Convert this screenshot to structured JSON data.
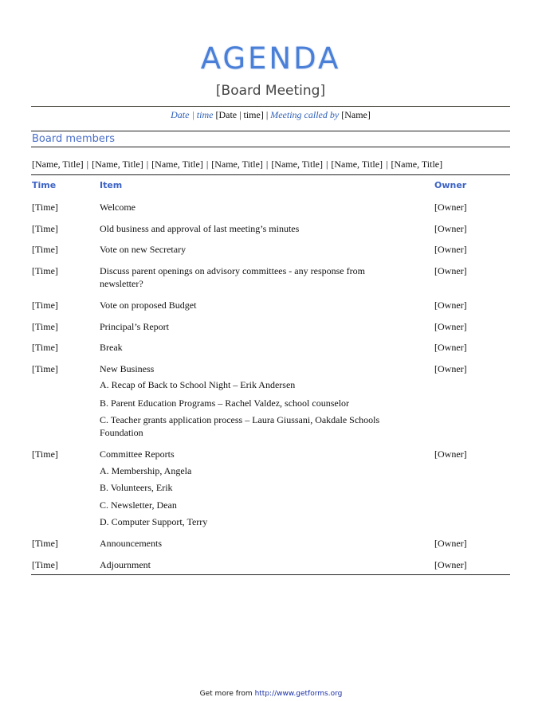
{
  "header": {
    "title": "AGENDA",
    "subtitle": "[Board Meeting]"
  },
  "meta": {
    "date_label": "Date",
    "sep1": "|",
    "time_label": "time",
    "date_time_value": "[Date | time]",
    "sep2": "|",
    "called_by_label": "Meeting called by",
    "called_by_value": "[Name]"
  },
  "board": {
    "heading": "Board members",
    "members": [
      "[Name, Title]",
      "[Name, Title]",
      "[Name, Title]",
      "[Name, Title]",
      "[Name, Title]",
      "[Name, Title]",
      "[Name, Title]"
    ],
    "separator": "|"
  },
  "table": {
    "headers": {
      "time": "Time",
      "item": "Item",
      "owner": "Owner"
    },
    "rows": [
      {
        "time": "[Time]",
        "item": "Welcome",
        "owner": "[Owner]"
      },
      {
        "time": "[Time]",
        "item": "Old business and approval of last meeting’s minutes",
        "owner": "[Owner]"
      },
      {
        "time": "[Time]",
        "item": "Vote on new Secretary",
        "owner": "[Owner]"
      },
      {
        "time": "[Time]",
        "item": "Discuss parent openings on advisory committees - any response from newsletter?",
        "owner": "[Owner]"
      },
      {
        "time": "[Time]",
        "item": "Vote on proposed Budget",
        "owner": "[Owner]"
      },
      {
        "time": "[Time]",
        "item": "Principal’s Report",
        "owner": "[Owner]"
      },
      {
        "time": "[Time]",
        "item": "Break",
        "owner": "[Owner]"
      },
      {
        "time": "[Time]",
        "item": "New Business",
        "owner": "[Owner]",
        "subitems": [
          "A. Recap of Back to School Night – Erik Andersen",
          "B. Parent Education Programs – Rachel Valdez, school counselor",
          "C. Teacher grants application process – Laura Giussani, Oakdale Schools Foundation"
        ]
      },
      {
        "time": "[Time]",
        "item": "Committee Reports",
        "owner": "[Owner]",
        "subitems": [
          "A. Membership, Angela",
          "B. Volunteers, Erik",
          "C. Newsletter, Dean",
          "D. Computer Support, Terry"
        ]
      },
      {
        "time": "[Time]",
        "item": "Announcements",
        "owner": "[Owner]"
      },
      {
        "time": "[Time]",
        "item": "Adjournment",
        "owner": "[Owner]"
      }
    ]
  },
  "footer": {
    "prefix": "Get more from",
    "link": "http://www.getforms.org"
  }
}
